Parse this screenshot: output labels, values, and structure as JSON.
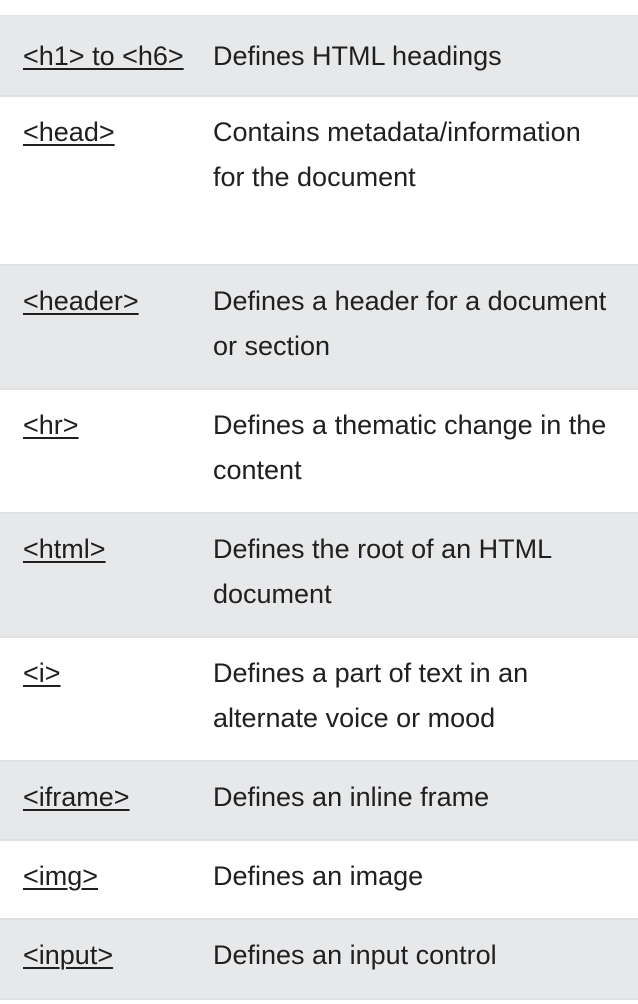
{
  "rows": [
    {
      "tag": "<h1> to <h6>",
      "desc": "Defines HTML headings"
    },
    {
      "tag": "<head>",
      "desc": "Contains metadata/information for the document"
    },
    {
      "tag": "<header>",
      "desc": "Defines a header for a document or section"
    },
    {
      "tag": "<hr>",
      "desc": "Defines a thematic change in the content"
    },
    {
      "tag": "<html>",
      "desc": "Defines the root of an HTML document"
    },
    {
      "tag": "<i>",
      "desc": "Defines a part of text in an alternate voice or mood"
    },
    {
      "tag": "<iframe>",
      "desc": "Defines an inline frame"
    },
    {
      "tag": "<img>",
      "desc": "Defines an image"
    },
    {
      "tag": "<input>",
      "desc": "Defines an input control"
    }
  ]
}
